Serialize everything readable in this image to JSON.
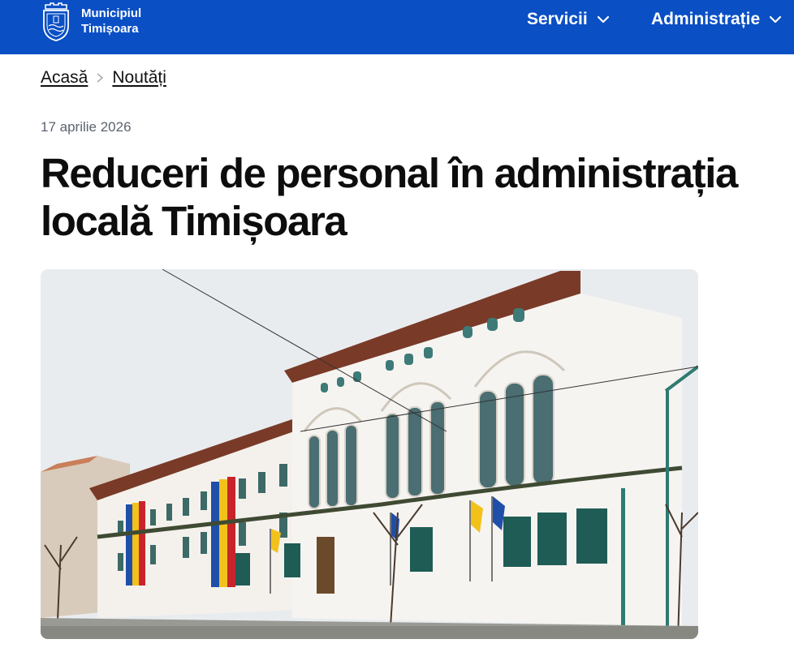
{
  "header": {
    "brand_line1": "Municipiul",
    "brand_line2": "Timișoara",
    "nav": [
      {
        "label": "Servicii"
      },
      {
        "label": "Administrație"
      }
    ]
  },
  "breadcrumb": {
    "items": [
      {
        "label": "Acasă"
      },
      {
        "label": "Noutăți"
      }
    ]
  },
  "article": {
    "date": "17 aprilie 2026",
    "title": "Reduceri de personal în administrația locală Timișoara"
  },
  "colors": {
    "header_bg": "#0a4fc4",
    "text": "#111111",
    "meta": "#5a6270"
  },
  "icons": {
    "logo": "city-coat-of-arms-icon",
    "dropdown": "chevron-down-icon",
    "separator": "chevron-right-icon"
  }
}
